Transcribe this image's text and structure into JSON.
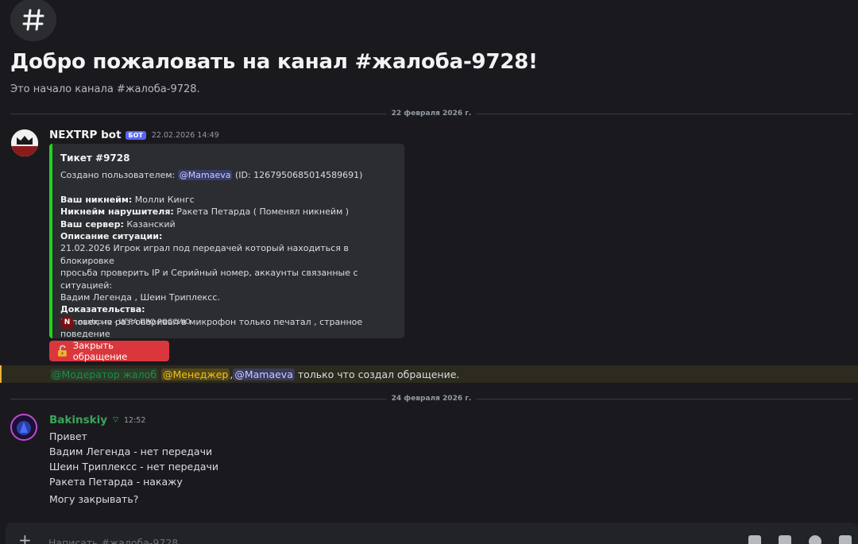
{
  "channel": {
    "welcome_title": "Добро пожаловать на канал #жалоба-9728!",
    "welcome_subtitle": "Это начало канала #жалоба-9728."
  },
  "dividers": [
    "22 февраля 2026 г.",
    "24 февраля 2026 г."
  ],
  "bot_message": {
    "username": "NEXTRP bot",
    "badge": "БОТ",
    "timestamp": "22.02.2026 14:49",
    "embed": {
      "title": "Тикет #9728",
      "created_prefix": "Создано пользователем: ",
      "created_mention": "@Mamaeva",
      "created_suffix": " (ID: 1267950685014589691)",
      "fields": [
        {
          "label": "Ваш никнейм:",
          "value": " Молли Кингс"
        },
        {
          "label": "Никнейм нарушителя:",
          "value": " Ракета Петарда ( Поменял никнейм )"
        },
        {
          "label": "Ваш сервер:",
          "value": " Казанский"
        }
      ],
      "situation_label": "Описание ситуации:",
      "situation_lines": [
        "21.02.2026 Игрок играл под передачей который находиться в блокировке",
        "просьба проверить IP и Серийный номер, аккаунты связанные с ситуацией:",
        "Вадим Легенда , Шеин Триплексс."
      ],
      "evidence_label": "Доказательства:",
      "evidence_text": "Человек не разговаривал в микрофон только печатал , странное поведение",
      "footer_logo": "N",
      "footer_text": "nextrp.ru - ИГРА ПРО РОССИЮ"
    },
    "close_button": "Закрыть обращение"
  },
  "notice": {
    "role_moderator": "@Модератор жалоб",
    "role_manager": "@Менеджер",
    "comma": ",",
    "user_mention": "@Mamaeva",
    "text": " только что создал обращение."
  },
  "user_message": {
    "username": "Bakinskiy",
    "tag_icon": "▽",
    "timestamp": "12:52",
    "username_color": "#3ba55d",
    "lines": [
      "Привет",
      "Вадим Легенда - нет передачи",
      "Шеин Триплексс - нет передачи",
      "Ракета Петарда - накажу",
      "Могу закрывать?"
    ]
  },
  "composer": {
    "placeholder": "Написать #жалоба-9728"
  },
  "colors": {
    "embed_accent": "#1ed61e",
    "bot_badge": "#5865f2",
    "close_button": "#da373c",
    "mention_highlight": "#f0b232"
  }
}
